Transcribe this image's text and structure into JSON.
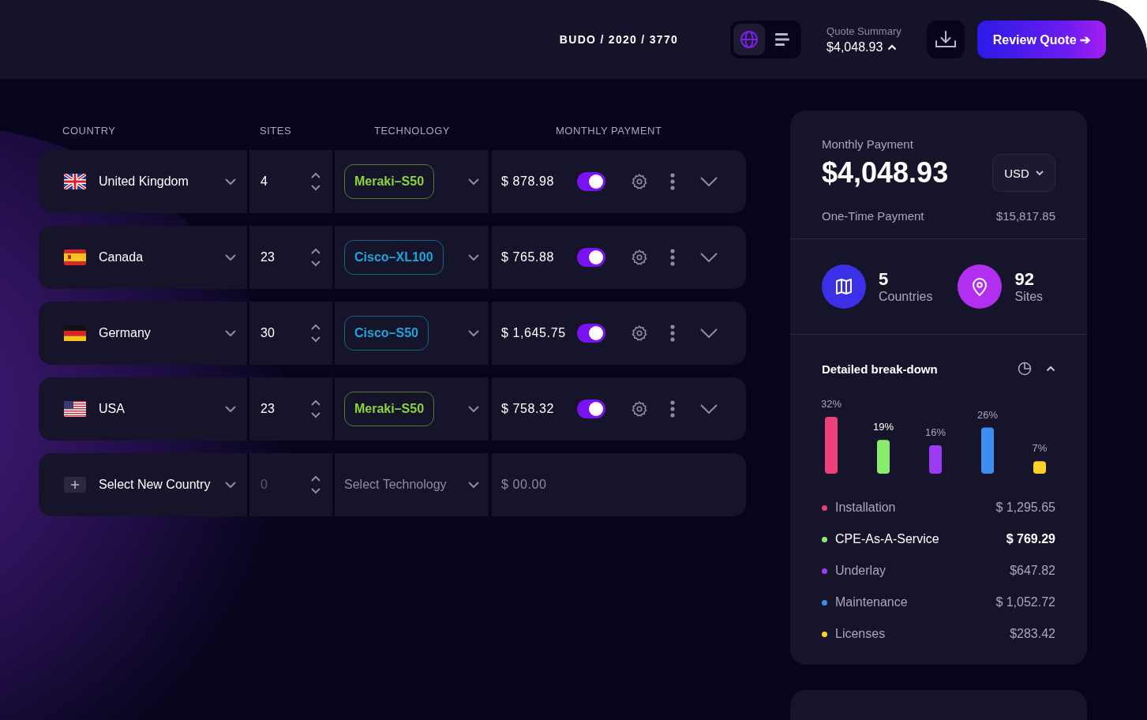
{
  "header": {
    "breadcrumb": "BUDO / 2020 / 3770",
    "view_toggle": [
      {
        "kind": "globe",
        "selected": true
      },
      {
        "kind": "list",
        "selected": false
      }
    ],
    "quote_summary": {
      "label": "Quote Summary",
      "amount": "$4,048.93",
      "expanded": true
    },
    "review_button": "Review Quote ➔"
  },
  "table": {
    "columns": [
      "COUNTRY",
      "SITES",
      "TECHNOLOGY",
      "MONTHLY PAYMENT"
    ],
    "rows": [
      {
        "kind": "uk",
        "country": "United Kingdom",
        "sites": "4",
        "technology": "Meraki–S50",
        "color": "#8bd53b",
        "payment": "$ 878.98",
        "on": true
      },
      {
        "kind": "spain",
        "country": "Canada",
        "sites": "23",
        "technology": "Cisco–XL100",
        "color": "#1ea5d9",
        "payment": "$ 765.88",
        "on": true
      },
      {
        "kind": "germany",
        "country": "Germany",
        "sites": "30",
        "technology": "Cisco–S50",
        "color": "#1ea5d9",
        "payment": "$ 1,645.75",
        "on": true
      },
      {
        "kind": "usa",
        "country": "USA",
        "sites": "23",
        "technology": "Meraki–S50",
        "color": "#8bd53b",
        "payment": "$ 758.32",
        "on": true
      }
    ],
    "new_row": {
      "country": "Select New Country",
      "sites": "0",
      "technology": "Select Technology",
      "payment": "$ 00.00"
    }
  },
  "summary": {
    "monthly_label": "Monthly Payment",
    "monthly_amount": "$4,048.93",
    "currency": "USD",
    "one_time_label": "One-Time Payment",
    "one_time_amount": "$15,817.85",
    "stats": [
      {
        "kind": "map",
        "value": "5",
        "label": "Countries"
      },
      {
        "kind": "pin",
        "value": "92",
        "label": "Sites"
      }
    ],
    "breakdown": {
      "title": "Detailed break-down",
      "expanded": true,
      "bar_labels": [
        "32%",
        "19%",
        "16%",
        "26%",
        "7%"
      ],
      "items": [
        {
          "label": "Installation",
          "amount": "$ 1,295.65",
          "color": "#ec407a",
          "selected": false
        },
        {
          "label": "CPE-As-A-Service",
          "amount": "$ 769.29",
          "color": "#86ee6c",
          "selected": true
        },
        {
          "label": "Underlay",
          "amount": "$647.82",
          "color": "#9b3cf2",
          "selected": false
        },
        {
          "label": "Maintenance",
          "amount": "$ 1,052.72",
          "color": "#3e8ef0",
          "selected": false
        },
        {
          "label": "Licenses",
          "amount": "$283.42",
          "color": "#fcd12a",
          "selected": false
        }
      ]
    }
  }
}
